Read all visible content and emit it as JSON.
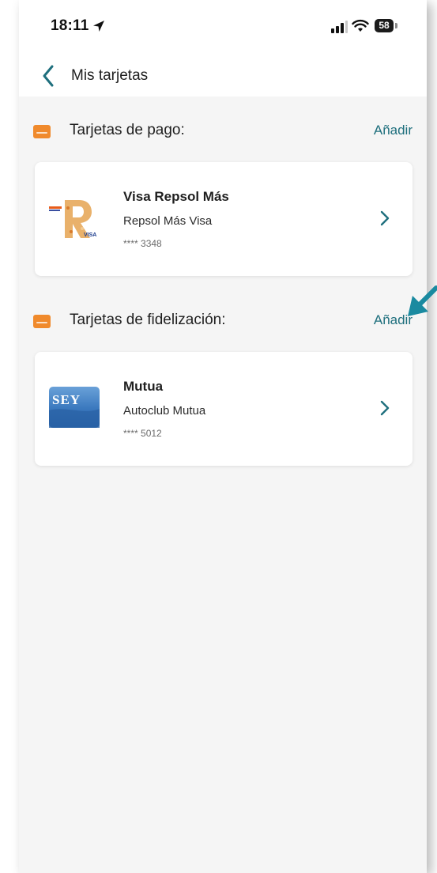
{
  "status_bar": {
    "time": "18:11",
    "battery": "58"
  },
  "nav": {
    "title": "Mis tarjetas"
  },
  "sections": [
    {
      "title": "Tarjetas de pago:",
      "add_label": "Añadir",
      "cards": [
        {
          "name": "Visa Repsol Más",
          "type": "Repsol Más Visa",
          "number": "**** 3348",
          "thumb_text": "VISA"
        }
      ]
    },
    {
      "title": "Tarjetas de fidelización:",
      "add_label": "Añadir",
      "cards": [
        {
          "name": "Mutua",
          "type": "Autoclub Mutua",
          "number": "**** 5012",
          "thumb_text": "SEY"
        }
      ]
    }
  ],
  "colors": {
    "accent": "#1e6f7d",
    "section_icon": "#f08a2c",
    "background": "#f5f5f5",
    "annotation_arrow": "#1a8aa0"
  },
  "icons": {
    "back": "chevron-left-icon",
    "section": "card-icon",
    "row": "chevron-right-icon",
    "location": "location-arrow-icon",
    "signal": "signal-icon",
    "wifi": "wifi-icon",
    "battery": "battery-icon"
  }
}
